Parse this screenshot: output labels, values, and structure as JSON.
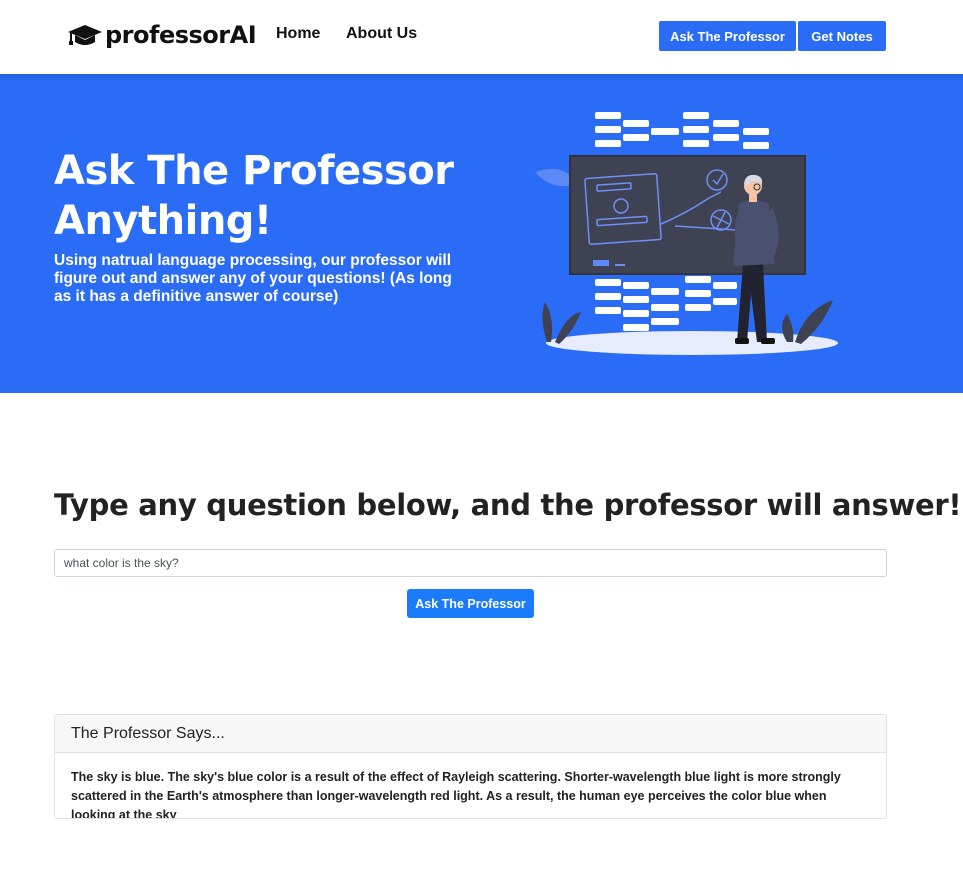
{
  "nav": {
    "brand": "professorAI",
    "links": [
      {
        "label": "Home"
      },
      {
        "label": "About Us"
      }
    ],
    "ask_button": "Ask The Professor",
    "notes_button": "Get Notes"
  },
  "hero": {
    "title": "Ask The Professor Anything!",
    "subtitle": "Using natrual language processing, our professor will figure out and answer any of your questions! (As long as it has a definitive answer of course)",
    "illustration_icon": "professor-chalkboard-illustration"
  },
  "question": {
    "heading": "Type any question below, and the professor will answer!",
    "input_value": "what color is the sky?",
    "input_placeholder": "",
    "submit_label": "Ask The Professor"
  },
  "answer": {
    "header": "The Professor Says...",
    "body": "The sky is blue. The sky's blue color is a result of the effect of Rayleigh scattering. Shorter-wavelength blue light is more strongly scattered in the Earth's atmosphere than longer-wavelength red light. As a result, the human eye perceives the color blue when looking at the sky"
  },
  "colors": {
    "primary": "#2a6cf6",
    "submit": "#1a7cfa",
    "dark_board": "#3f4253"
  }
}
